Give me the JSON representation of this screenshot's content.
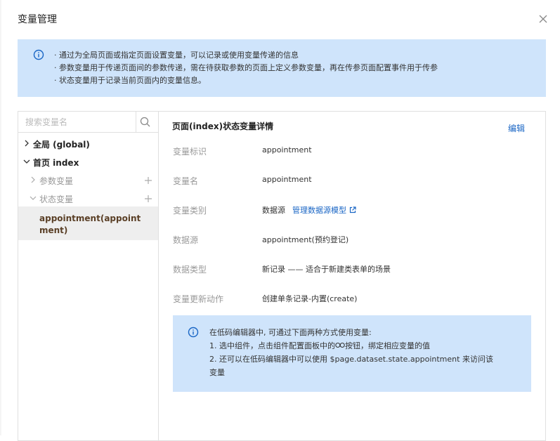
{
  "dialog": {
    "title": "变量管理"
  },
  "info_banner": {
    "lines": [
      "· 通过为全局页面或指定页面设置变量，可以记录或使用变量传递的信息",
      "· 参数变量用于传递页面间的参数传递，需在待获取参数的页面上定义参数变量，再在传参页面配置事件用于传参",
      "· 状态变量用于记录当前页面内的变量信息。"
    ]
  },
  "search": {
    "placeholder": "搜索变量名"
  },
  "tree": {
    "global": "全局 (global)",
    "index_page": "首页 index",
    "param_vars": "参数变量",
    "state_vars": "状态变量",
    "selected": "appointment(appointment)"
  },
  "detail": {
    "title": "页面(index)状态变量详情",
    "edit_label": "编辑",
    "fields": [
      {
        "label": "变量标识",
        "value": "appointment"
      },
      {
        "label": "变量名",
        "value": "appointment"
      },
      {
        "label": "变量类别",
        "value": "数据源",
        "link": "管理数据源模型"
      },
      {
        "label": "数据源",
        "value": "appointment(预约登记)"
      },
      {
        "label": "数据类型",
        "value": "新记录 —— 适合于新建类表单的场景"
      },
      {
        "label": "变量更新动作",
        "value": "创建单条记录-内置(create)"
      }
    ]
  },
  "tip": {
    "line1": "在低码编辑器中, 可通过下面两种方式使用变量:",
    "line2a": "1. 选中组件，点击组件配置面板中的",
    "line2b": "按钮，绑定相应变量的值",
    "line3": "2. 还可以在低码编辑器中可以使用 $page.dataset.state.appointment 来访问该",
    "line4": "变量"
  },
  "colors": {
    "accent": "#1a66c5",
    "info_bg": "#cfe4fb",
    "selected_bg": "#eeeeee"
  },
  "icons": [
    "info-icon",
    "close-icon",
    "search-icon",
    "chevron-right-icon",
    "chevron-down-icon",
    "plus-icon",
    "external-link-icon",
    "link-icon"
  ]
}
